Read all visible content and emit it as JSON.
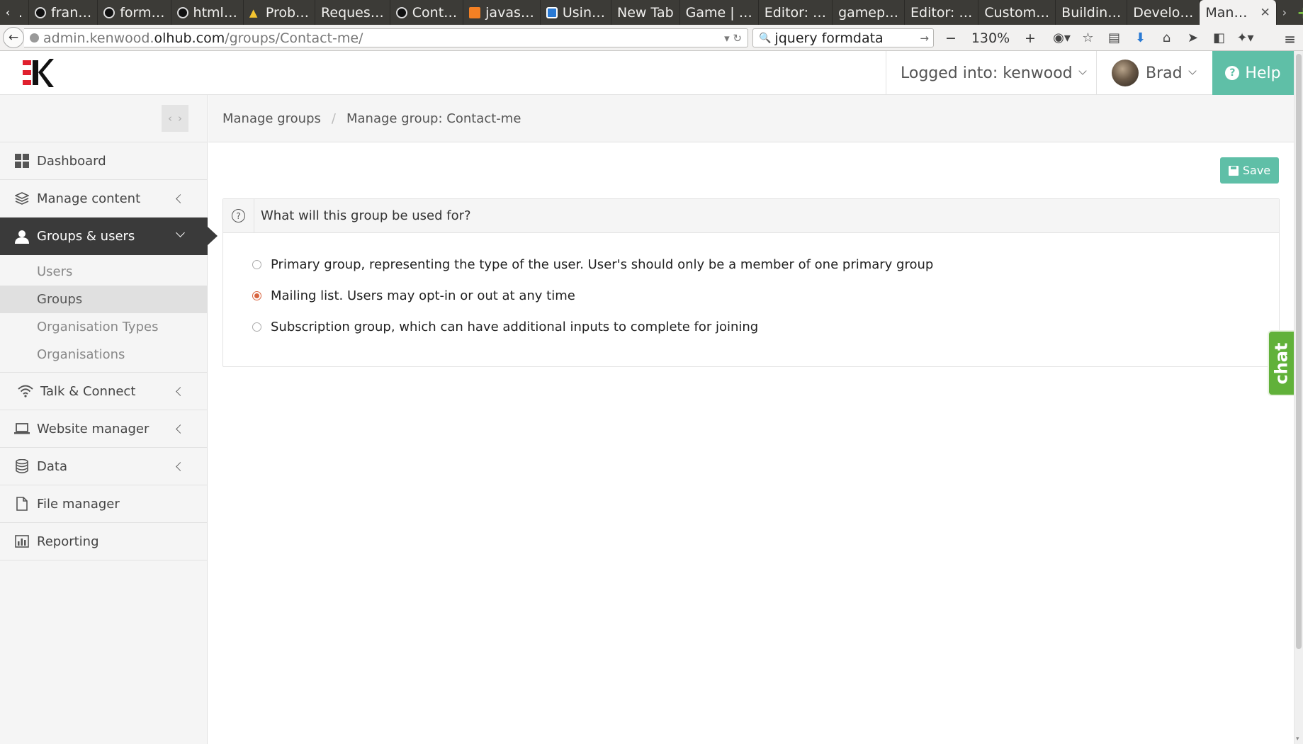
{
  "browser": {
    "tabs": [
      {
        "label": "fran…",
        "icon": "github-icon"
      },
      {
        "label": "form…",
        "icon": "github-icon"
      },
      {
        "label": "html…",
        "icon": "github-icon"
      },
      {
        "label": "Prob…",
        "icon": "warning-icon"
      },
      {
        "label": "Reques…",
        "icon": ""
      },
      {
        "label": "Cont…",
        "icon": "github-icon"
      },
      {
        "label": "javas…",
        "icon": "stackoverflow-icon"
      },
      {
        "label": "Usin…",
        "icon": "page-icon"
      },
      {
        "label": "New Tab",
        "icon": ""
      },
      {
        "label": "Game | …",
        "icon": ""
      },
      {
        "label": "Editor: …",
        "icon": ""
      },
      {
        "label": "gamep…",
        "icon": ""
      },
      {
        "label": "Editor: …",
        "icon": ""
      },
      {
        "label": "Custom…",
        "icon": ""
      },
      {
        "label": "Buildin…",
        "icon": ""
      },
      {
        "label": "Develo…",
        "icon": ""
      }
    ],
    "active_tab": "Man…",
    "url_prefix": "admin.kenwood.",
    "url_domain": "olhub.com",
    "url_path": "/groups/Contact-me/",
    "search_value": "jquery formdata",
    "zoom": "130%"
  },
  "header": {
    "logged_in": "Logged into: kenwood",
    "user_name": "Brad",
    "help_label": "Help",
    "brand_color": "#5fbfa7",
    "logo_color": "#e0202e"
  },
  "sidebar": {
    "items": [
      {
        "label": "Dashboard",
        "icon": "dashboard-icon"
      },
      {
        "label": "Manage content",
        "icon": "layers-icon"
      },
      {
        "label": "Groups & users",
        "icon": "user-icon"
      },
      {
        "label": "Talk & Connect",
        "icon": "wifi-icon"
      },
      {
        "label": "Website manager",
        "icon": "laptop-icon"
      },
      {
        "label": "Data",
        "icon": "database-icon"
      },
      {
        "label": "File manager",
        "icon": "file-icon"
      },
      {
        "label": "Reporting",
        "icon": "bar-chart-icon"
      }
    ],
    "sub_items": [
      "Users",
      "Groups",
      "Organisation Types",
      "Organisations"
    ]
  },
  "main": {
    "breadcrumb": [
      "Manage groups",
      "Manage group: Contact-me"
    ],
    "save_label": "Save",
    "question": "What will this group be used for?",
    "options": [
      "Primary group, representing the type of the user. User's should only be a member of one primary group",
      "Mailing list. Users may opt-in or out at any time",
      "Subscription group, which can have additional inputs to complete for joining"
    ],
    "selected_option": "Mailing list. Users may opt-in or out at any time"
  },
  "chat_label": "chat"
}
